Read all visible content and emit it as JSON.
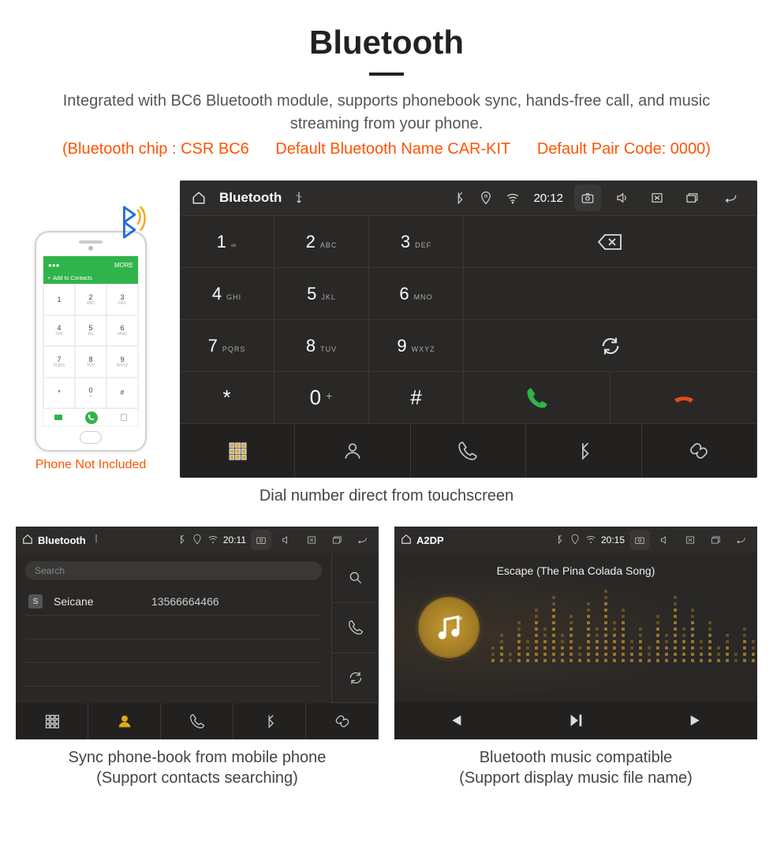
{
  "header": {
    "title": "Bluetooth",
    "subtitle": "Integrated with BC6 Bluetooth module, supports phonebook sync, hands-free call, and music streaming from your phone.",
    "tech_chip": "(Bluetooth chip : CSR BC6",
    "tech_name": "Default Bluetooth Name CAR-KIT",
    "tech_pair": "Default Pair Code: 0000)"
  },
  "phone": {
    "caption": "Phone Not Included",
    "add_contacts": "Add to Contacts",
    "more": "MORE",
    "keys": [
      {
        "n": "1",
        "s": ""
      },
      {
        "n": "2",
        "s": "ABC"
      },
      {
        "n": "3",
        "s": "DEF"
      },
      {
        "n": "4",
        "s": "GHI"
      },
      {
        "n": "5",
        "s": "JKL"
      },
      {
        "n": "6",
        "s": "MNO"
      },
      {
        "n": "7",
        "s": "PQRS"
      },
      {
        "n": "8",
        "s": "TUV"
      },
      {
        "n": "9",
        "s": "WXYZ"
      },
      {
        "n": "*",
        "s": ""
      },
      {
        "n": "0",
        "s": "+"
      },
      {
        "n": "#",
        "s": ""
      }
    ]
  },
  "dialer": {
    "app_title": "Bluetooth",
    "clock": "20:12",
    "keys": [
      {
        "n": "1",
        "s": "∞"
      },
      {
        "n": "2",
        "s": "ABC"
      },
      {
        "n": "3",
        "s": "DEF"
      },
      {
        "n": "4",
        "s": "GHI"
      },
      {
        "n": "5",
        "s": "JKL"
      },
      {
        "n": "6",
        "s": "MNO"
      },
      {
        "n": "7",
        "s": "PQRS"
      },
      {
        "n": "8",
        "s": "TUV"
      },
      {
        "n": "9",
        "s": "WXYZ"
      },
      {
        "n": "*",
        "s": ""
      },
      {
        "n": "0",
        "s": "+"
      },
      {
        "n": "#",
        "s": ""
      }
    ],
    "caption": "Dial number direct from touchscreen"
  },
  "contacts_card": {
    "app_title": "Bluetooth",
    "clock": "20:11",
    "search_placeholder": "Search",
    "contact_letter": "S",
    "contact_name": "Seicane",
    "contact_number": "13566664466",
    "caption_l1": "Sync phone-book from mobile phone",
    "caption_l2": "(Support contacts searching)"
  },
  "music_card": {
    "app_title": "A2DP",
    "clock": "20:15",
    "track": "Escape (The Pina Colada Song)",
    "caption_l1": "Bluetooth music compatible",
    "caption_l2": "(Support display music file name)"
  }
}
